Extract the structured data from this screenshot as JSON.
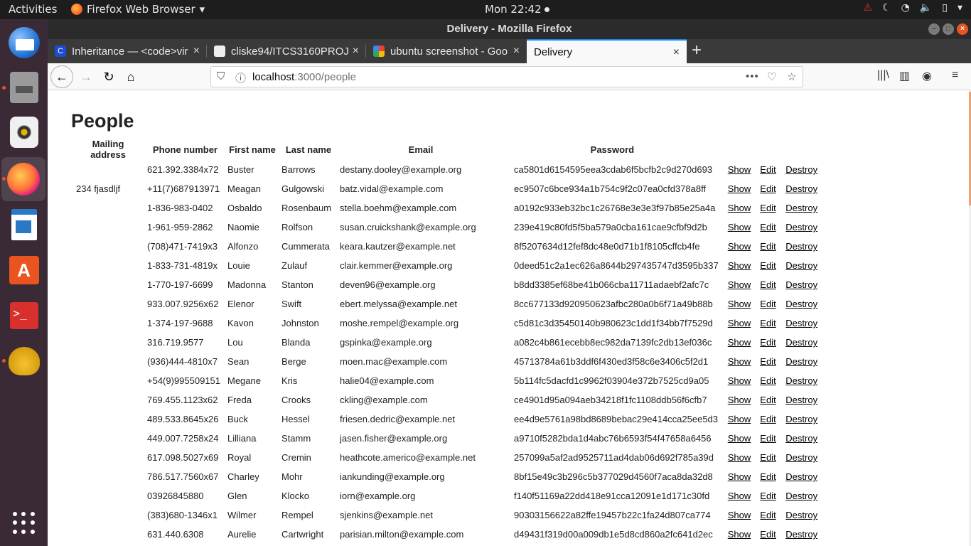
{
  "topbar": {
    "activities": "Activities",
    "app_name": "Firefox Web Browser",
    "clock": "Mon 22:42"
  },
  "window": {
    "title": "Delivery - Mozilla Firefox"
  },
  "tabs": [
    {
      "label": "Inheritance — <code>vir",
      "favicon": "mdn-icon"
    },
    {
      "label": "cliske94/ITCS3160PROJE",
      "favicon": "github-icon"
    },
    {
      "label": "ubuntu screenshot - Goo",
      "favicon": "google-icon"
    },
    {
      "label": "Delivery",
      "favicon": "none",
      "selected": true
    }
  ],
  "urlbar": {
    "host": "localhost",
    "path": ":3000/people"
  },
  "page": {
    "title": "People",
    "columns": [
      "Mailing address",
      "Phone number",
      "First name",
      "Last name",
      "Email",
      "Password"
    ],
    "action_labels": {
      "show": "Show",
      "edit": "Edit",
      "destroy": "Destroy"
    },
    "rows": [
      {
        "address": "",
        "phone": "621.392.3384x72",
        "first": "Buster",
        "last": "Barrows",
        "email": "destany.dooley@example.org",
        "password": "ca5801d6154595eea3cdab6f5bcfb2c9d270d693"
      },
      {
        "address": "234 fjasdljf",
        "phone": "+11(7)687913971",
        "first": "Meagan",
        "last": "Gulgowski",
        "email": "batz.vidal@example.com",
        "password": "ec9507c6bce934a1b754c9f2c07ea0cfd378a8ff"
      },
      {
        "address": "",
        "phone": "1-836-983-0402",
        "first": "Osbaldo",
        "last": "Rosenbaum",
        "email": "stella.boehm@example.com",
        "password": "a0192c933eb32bc1c26768e3e3e3f97b85e25a4a"
      },
      {
        "address": "",
        "phone": "1-961-959-2862",
        "first": "Naomie",
        "last": "Rolfson",
        "email": "susan.cruickshank@example.org",
        "password": "239e419c80fd5f5ba579a0cba161cae9cfbf9d2b"
      },
      {
        "address": "",
        "phone": "(708)471-7419x3",
        "first": "Alfonzo",
        "last": "Cummerata",
        "email": "keara.kautzer@example.net",
        "password": "8f5207634d12fef8dc48e0d71b1f8105cffcb4fe"
      },
      {
        "address": "",
        "phone": "1-833-731-4819x",
        "first": "Louie",
        "last": "Zulauf",
        "email": "clair.kemmer@example.org",
        "password": "0deed51c2a1ec626a8644b297435747d3595b337"
      },
      {
        "address": "",
        "phone": "1-770-197-6699",
        "first": "Madonna",
        "last": "Stanton",
        "email": "deven96@example.org",
        "password": "b8dd3385ef68be41b066cba11711adaebf2afc7c"
      },
      {
        "address": "",
        "phone": "933.007.9256x62",
        "first": "Elenor",
        "last": "Swift",
        "email": "ebert.melyssa@example.net",
        "password": "8cc677133d920950623afbc280a0b6f71a49b88b"
      },
      {
        "address": "",
        "phone": "1-374-197-9688",
        "first": "Kavon",
        "last": "Johnston",
        "email": "moshe.rempel@example.org",
        "password": "c5d81c3d35450140b980623c1dd1f34bb7f7529d"
      },
      {
        "address": "",
        "phone": "316.719.9577",
        "first": "Lou",
        "last": "Blanda",
        "email": "gspinka@example.org",
        "password": "a082c4b861ecebb8ec982da7139fc2db13ef036c"
      },
      {
        "address": "",
        "phone": "(936)444-4810x7",
        "first": "Sean",
        "last": "Berge",
        "email": "moen.mac@example.com",
        "password": "45713784a61b3ddf6f430ed3f58c6e3406c5f2d1"
      },
      {
        "address": "",
        "phone": "+54(9)995509151",
        "first": "Megane",
        "last": "Kris",
        "email": "halie04@example.com",
        "password": "5b114fc5dacfd1c9962f03904e372b7525cd9a05"
      },
      {
        "address": "",
        "phone": "769.455.1123x62",
        "first": "Freda",
        "last": "Crooks",
        "email": "ckling@example.com",
        "password": "ce4901d95a094aeb34218f1fc1108ddb56f6cfb7"
      },
      {
        "address": "",
        "phone": "489.533.8645x26",
        "first": "Buck",
        "last": "Hessel",
        "email": "friesen.dedric@example.net",
        "password": "ee4d9e5761a98bd8689bebac29e414cca25ee5d3"
      },
      {
        "address": "",
        "phone": "449.007.7258x24",
        "first": "Lilliana",
        "last": "Stamm",
        "email": "jasen.fisher@example.org",
        "password": "a9710f5282bda1d4abc76b6593f54f47658a6456"
      },
      {
        "address": "",
        "phone": "617.098.5027x69",
        "first": "Royal",
        "last": "Cremin",
        "email": "heathcote.americo@example.net",
        "password": "257099a5af2ad9525711ad4dab06d692f785a39d"
      },
      {
        "address": "",
        "phone": "786.517.7560x67",
        "first": "Charley",
        "last": "Mohr",
        "email": "iankunding@example.org",
        "password": "8bf15e49c3b296c5b377029d4560f7aca8da32d8"
      },
      {
        "address": "",
        "phone": "03926845880",
        "first": "Glen",
        "last": "Klocko",
        "email": "iorn@example.org",
        "password": "f140f51169a22dd418e91cca12091e1d171c30fd"
      },
      {
        "address": "",
        "phone": "(383)680-1346x1",
        "first": "Wilmer",
        "last": "Rempel",
        "email": "sjenkins@example.net",
        "password": "90303156622a82ffe19457b22c1fa24d807ca774"
      },
      {
        "address": "",
        "phone": "631.440.6308",
        "first": "Aurelie",
        "last": "Cartwright",
        "email": "parisian.milton@example.com",
        "password": "d49431f319d00a009db1e5d8cd860a2fc641d2ec"
      }
    ]
  }
}
